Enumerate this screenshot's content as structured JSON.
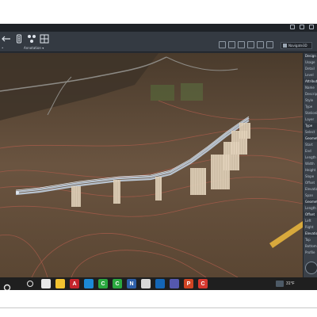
{
  "ribbon": {
    "annotation_label": "Annotation ▾",
    "left_label": "•",
    "view_select": "Navigate3D"
  },
  "properties_panel": {
    "rows": [
      {
        "label": "Design",
        "section": true
      },
      {
        "label": "Usage",
        "section": false
      },
      {
        "label": "Detail",
        "section": false
      },
      {
        "label": "Level",
        "section": false
      },
      {
        "label": "Attributes",
        "section": true
      },
      {
        "label": "Name",
        "section": false
      },
      {
        "label": "Description",
        "section": false
      },
      {
        "label": "Style",
        "section": false
      },
      {
        "label": "Type",
        "section": false
      },
      {
        "label": "Stationing",
        "section": false
      },
      {
        "label": "Layer",
        "section": false
      },
      {
        "label": "Type",
        "section": true
      },
      {
        "label": "Select",
        "section": false
      },
      {
        "label": "Geometry",
        "section": true
      },
      {
        "label": "Start",
        "section": false
      },
      {
        "label": "End",
        "section": false
      },
      {
        "label": "Length",
        "section": false
      },
      {
        "label": "Width",
        "section": false
      },
      {
        "label": "Height",
        "section": false
      },
      {
        "label": "Slope",
        "section": false
      },
      {
        "label": "Offset",
        "section": false
      },
      {
        "label": "Elevation",
        "section": false
      },
      {
        "label": "Span",
        "section": false
      },
      {
        "label": "Geometry",
        "section": true
      },
      {
        "label": "Length",
        "section": false
      },
      {
        "label": "Offset",
        "section": true
      },
      {
        "label": "Left",
        "section": false
      },
      {
        "label": "Right",
        "section": false
      },
      {
        "label": "Elevation",
        "section": true
      },
      {
        "label": "Top",
        "section": false
      },
      {
        "label": "Bottom",
        "section": false
      },
      {
        "label": "Profile",
        "section": false
      }
    ]
  },
  "taskbar": {
    "apps": [
      {
        "name": "chrome",
        "glyph": "",
        "color": "#e8e8e8"
      },
      {
        "name": "file-explorer",
        "glyph": "",
        "color": "#f2c230"
      },
      {
        "name": "acrobat",
        "glyph": "A",
        "color": "#c4242b"
      },
      {
        "name": "edge",
        "glyph": "",
        "color": "#1c8ad6"
      },
      {
        "name": "civil3d-1",
        "glyph": "C",
        "color": "#2aa83f"
      },
      {
        "name": "civil3d-2",
        "glyph": "C",
        "color": "#2aa83f"
      },
      {
        "name": "navisworks",
        "glyph": "N",
        "color": "#2d5fa8"
      },
      {
        "name": "pdf-viewer",
        "glyph": "",
        "color": "#d9d9d9"
      },
      {
        "name": "outlook",
        "glyph": "",
        "color": "#1466b6"
      },
      {
        "name": "teams",
        "glyph": "",
        "color": "#5558af"
      },
      {
        "name": "powerpoint",
        "glyph": "P",
        "color": "#d04423"
      },
      {
        "name": "app-red",
        "glyph": "C",
        "color": "#d6382f"
      }
    ],
    "temperature": "31°F"
  },
  "colors": {
    "terrain": "#5e4a36",
    "bridge_deck": "#b8c3cf",
    "pier": "#e6d6bf",
    "contour": "#a65a4a",
    "road_yellow": "#d8a93c"
  }
}
